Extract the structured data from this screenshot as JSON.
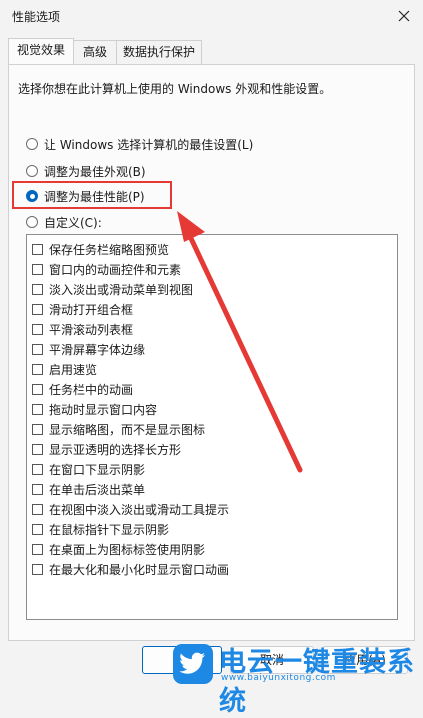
{
  "window": {
    "title": "性能选项"
  },
  "tabs": [
    {
      "label": "视觉效果"
    },
    {
      "label": "高级"
    },
    {
      "label": "数据执行保护"
    }
  ],
  "intro": "选择你想在此计算机上使用的 Windows 外观和性能设置。",
  "radios": [
    {
      "label": "让 Windows 选择计算机的最佳设置(L)",
      "checked": false
    },
    {
      "label": "调整为最佳外观(B)",
      "checked": false
    },
    {
      "label": "调整为最佳性能(P)",
      "checked": true
    },
    {
      "label": "自定义(C):",
      "checked": false
    }
  ],
  "options": [
    {
      "label": "保存任务栏缩略图预览",
      "checked": false
    },
    {
      "label": "窗口内的动画控件和元素",
      "checked": false
    },
    {
      "label": "淡入淡出或滑动菜单到视图",
      "checked": false
    },
    {
      "label": "滑动打开组合框",
      "checked": false
    },
    {
      "label": "平滑滚动列表框",
      "checked": false
    },
    {
      "label": "平滑屏幕字体边缘",
      "checked": false
    },
    {
      "label": "启用速览",
      "checked": false
    },
    {
      "label": "任务栏中的动画",
      "checked": false
    },
    {
      "label": "拖动时显示窗口内容",
      "checked": false
    },
    {
      "label": "显示缩略图，而不是显示图标",
      "checked": false
    },
    {
      "label": "显示亚透明的选择长方形",
      "checked": false
    },
    {
      "label": "在窗口下显示阴影",
      "checked": false
    },
    {
      "label": "在单击后淡出菜单",
      "checked": false
    },
    {
      "label": "在视图中淡入淡出或滑动工具提示",
      "checked": false
    },
    {
      "label": "在鼠标指针下显示阴影",
      "checked": false
    },
    {
      "label": "在桌面上为图标标签使用阴影",
      "checked": false
    },
    {
      "label": "在最大化和最小化时显示窗口动画",
      "checked": false
    }
  ],
  "buttons": {
    "cancel": "取消",
    "apply": "应用(A)"
  },
  "watermark": {
    "text": "电云一键重装系统",
    "url": "www.baiyunxitong.com"
  },
  "colors": {
    "accent": "#0067c0",
    "highlight": "#e53935",
    "watermark": "#1e88e5"
  }
}
